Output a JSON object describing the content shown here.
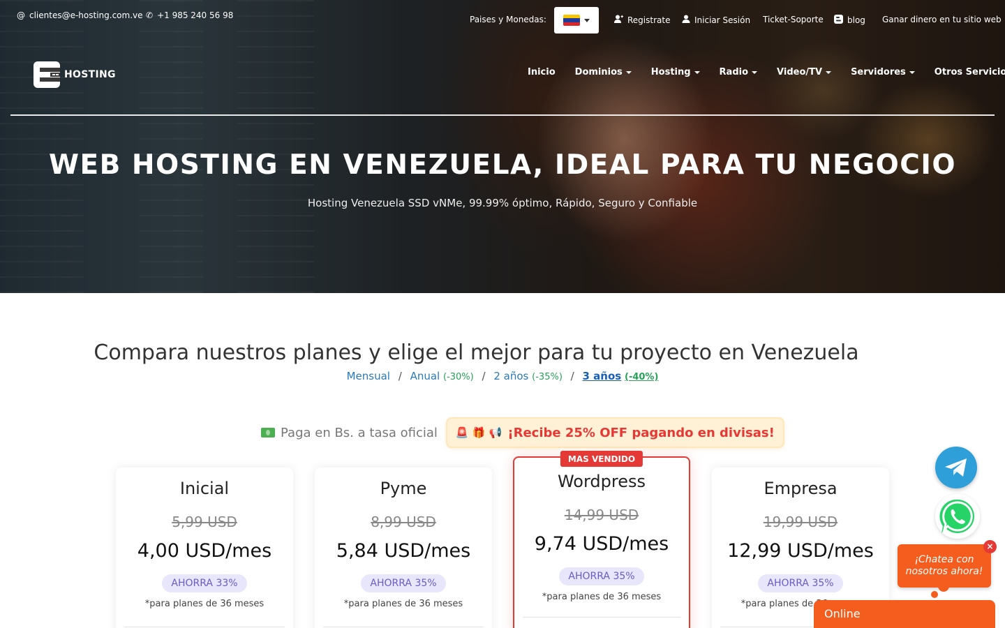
{
  "topbar": {
    "email": "clientes@e-hosting.com.ve",
    "phone": "+1 985 240 56 98",
    "countries_label": "Paises y Monedas:",
    "register": "Registrate",
    "login": "Iniciar Sesión",
    "ticket": "Ticket-Soporte",
    "blog": "blog",
    "affiliate": "Ganar dinero en tu sitio web",
    "flag_colors": [
      "#f7c600",
      "#1f3c9d",
      "#d9262a"
    ]
  },
  "brand": {
    "name": "HOSTING"
  },
  "nav": [
    {
      "label": "Inicio",
      "dropdown": false
    },
    {
      "label": "Dominios",
      "dropdown": true
    },
    {
      "label": "Hosting",
      "dropdown": true
    },
    {
      "label": "Radio",
      "dropdown": true
    },
    {
      "label": "Video/TV",
      "dropdown": true
    },
    {
      "label": "Servidores",
      "dropdown": true
    },
    {
      "label": "Otros Servicios",
      "dropdown": true
    }
  ],
  "hero": {
    "title": "WEB HOSTING EN VENEZUELA, IDEAL PARA TU NEGOCIO",
    "subtitle": "Hosting Venezuela SSD vNMe, 99.99% óptimo, Rápido, Seguro y Confiable"
  },
  "compare": {
    "title": "Compara nuestros planes y elige el mejor para tu proyecto en Venezuela",
    "periods": [
      {
        "label": "Mensual",
        "discount": ""
      },
      {
        "label": "Anual",
        "discount": "(-30%)"
      },
      {
        "label": "2 años",
        "discount": "(-35%)"
      },
      {
        "label": "3 años",
        "discount": "(-40%)",
        "active": true
      }
    ]
  },
  "payment": {
    "bs_text": "Paga en Bs. a tasa oficial",
    "promo_emojis": "🚨 🎁 📢",
    "promo_text": "¡Recibe 25% OFF pagando en divisas!"
  },
  "plans": [
    {
      "name": "Inicial",
      "old_price": "5,99 USD",
      "price": "4,00 USD/mes",
      "save": "AHORRA 33%",
      "note": "*para planes de 36 meses",
      "featured": false
    },
    {
      "name": "Pyme",
      "old_price": "8,99 USD",
      "price": "5,84 USD/mes",
      "save": "AHORRA 35%",
      "note": "*para planes de 36 meses",
      "featured": false
    },
    {
      "name": "Wordpress",
      "old_price": "14,99 USD",
      "price": "9,74 USD/mes",
      "save": "AHORRA 35%",
      "note": "*para planes de 36 meses",
      "featured": true,
      "ribbon": "MAS VENDIDO"
    },
    {
      "name": "Empresa",
      "old_price": "19,99 USD",
      "price": "12,99 USD/mes",
      "save": "AHORRA 35%",
      "note": "*para planes de 36 meses",
      "featured": false
    }
  ],
  "chat": {
    "bubble": "¡Chatea con nosotros ahora!",
    "close": "×",
    "status": "Online"
  }
}
